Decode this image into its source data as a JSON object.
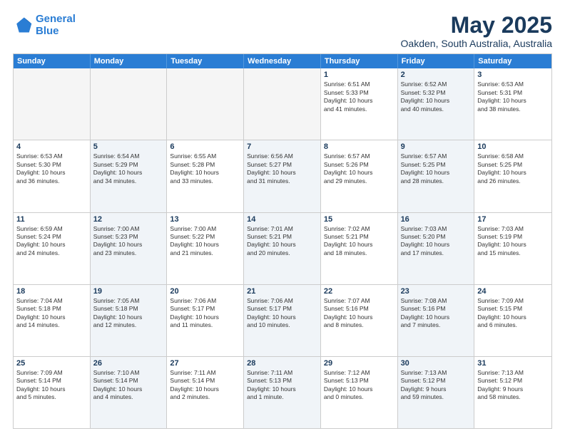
{
  "logo": {
    "line1": "General",
    "line2": "Blue"
  },
  "title": "May 2025",
  "subtitle": "Oakden, South Australia, Australia",
  "header_days": [
    "Sunday",
    "Monday",
    "Tuesday",
    "Wednesday",
    "Thursday",
    "Friday",
    "Saturday"
  ],
  "rows": [
    [
      {
        "day": "",
        "info": "",
        "empty": true
      },
      {
        "day": "",
        "info": "",
        "empty": true
      },
      {
        "day": "",
        "info": "",
        "empty": true
      },
      {
        "day": "",
        "info": "",
        "empty": true
      },
      {
        "day": "1",
        "info": "Sunrise: 6:51 AM\nSunset: 5:33 PM\nDaylight: 10 hours\nand 41 minutes.",
        "shaded": false
      },
      {
        "day": "2",
        "info": "Sunrise: 6:52 AM\nSunset: 5:32 PM\nDaylight: 10 hours\nand 40 minutes.",
        "shaded": true
      },
      {
        "day": "3",
        "info": "Sunrise: 6:53 AM\nSunset: 5:31 PM\nDaylight: 10 hours\nand 38 minutes.",
        "shaded": false
      }
    ],
    [
      {
        "day": "4",
        "info": "Sunrise: 6:53 AM\nSunset: 5:30 PM\nDaylight: 10 hours\nand 36 minutes.",
        "shaded": false
      },
      {
        "day": "5",
        "info": "Sunrise: 6:54 AM\nSunset: 5:29 PM\nDaylight: 10 hours\nand 34 minutes.",
        "shaded": true
      },
      {
        "day": "6",
        "info": "Sunrise: 6:55 AM\nSunset: 5:28 PM\nDaylight: 10 hours\nand 33 minutes.",
        "shaded": false
      },
      {
        "day": "7",
        "info": "Sunrise: 6:56 AM\nSunset: 5:27 PM\nDaylight: 10 hours\nand 31 minutes.",
        "shaded": true
      },
      {
        "day": "8",
        "info": "Sunrise: 6:57 AM\nSunset: 5:26 PM\nDaylight: 10 hours\nand 29 minutes.",
        "shaded": false
      },
      {
        "day": "9",
        "info": "Sunrise: 6:57 AM\nSunset: 5:25 PM\nDaylight: 10 hours\nand 28 minutes.",
        "shaded": true
      },
      {
        "day": "10",
        "info": "Sunrise: 6:58 AM\nSunset: 5:25 PM\nDaylight: 10 hours\nand 26 minutes.",
        "shaded": false
      }
    ],
    [
      {
        "day": "11",
        "info": "Sunrise: 6:59 AM\nSunset: 5:24 PM\nDaylight: 10 hours\nand 24 minutes.",
        "shaded": false
      },
      {
        "day": "12",
        "info": "Sunrise: 7:00 AM\nSunset: 5:23 PM\nDaylight: 10 hours\nand 23 minutes.",
        "shaded": true
      },
      {
        "day": "13",
        "info": "Sunrise: 7:00 AM\nSunset: 5:22 PM\nDaylight: 10 hours\nand 21 minutes.",
        "shaded": false
      },
      {
        "day": "14",
        "info": "Sunrise: 7:01 AM\nSunset: 5:21 PM\nDaylight: 10 hours\nand 20 minutes.",
        "shaded": true
      },
      {
        "day": "15",
        "info": "Sunrise: 7:02 AM\nSunset: 5:21 PM\nDaylight: 10 hours\nand 18 minutes.",
        "shaded": false
      },
      {
        "day": "16",
        "info": "Sunrise: 7:03 AM\nSunset: 5:20 PM\nDaylight: 10 hours\nand 17 minutes.",
        "shaded": true
      },
      {
        "day": "17",
        "info": "Sunrise: 7:03 AM\nSunset: 5:19 PM\nDaylight: 10 hours\nand 15 minutes.",
        "shaded": false
      }
    ],
    [
      {
        "day": "18",
        "info": "Sunrise: 7:04 AM\nSunset: 5:18 PM\nDaylight: 10 hours\nand 14 minutes.",
        "shaded": false
      },
      {
        "day": "19",
        "info": "Sunrise: 7:05 AM\nSunset: 5:18 PM\nDaylight: 10 hours\nand 12 minutes.",
        "shaded": true
      },
      {
        "day": "20",
        "info": "Sunrise: 7:06 AM\nSunset: 5:17 PM\nDaylight: 10 hours\nand 11 minutes.",
        "shaded": false
      },
      {
        "day": "21",
        "info": "Sunrise: 7:06 AM\nSunset: 5:17 PM\nDaylight: 10 hours\nand 10 minutes.",
        "shaded": true
      },
      {
        "day": "22",
        "info": "Sunrise: 7:07 AM\nSunset: 5:16 PM\nDaylight: 10 hours\nand 8 minutes.",
        "shaded": false
      },
      {
        "day": "23",
        "info": "Sunrise: 7:08 AM\nSunset: 5:16 PM\nDaylight: 10 hours\nand 7 minutes.",
        "shaded": true
      },
      {
        "day": "24",
        "info": "Sunrise: 7:09 AM\nSunset: 5:15 PM\nDaylight: 10 hours\nand 6 minutes.",
        "shaded": false
      }
    ],
    [
      {
        "day": "25",
        "info": "Sunrise: 7:09 AM\nSunset: 5:14 PM\nDaylight: 10 hours\nand 5 minutes.",
        "shaded": false
      },
      {
        "day": "26",
        "info": "Sunrise: 7:10 AM\nSunset: 5:14 PM\nDaylight: 10 hours\nand 4 minutes.",
        "shaded": true
      },
      {
        "day": "27",
        "info": "Sunrise: 7:11 AM\nSunset: 5:14 PM\nDaylight: 10 hours\nand 2 minutes.",
        "shaded": false
      },
      {
        "day": "28",
        "info": "Sunrise: 7:11 AM\nSunset: 5:13 PM\nDaylight: 10 hours\nand 1 minute.",
        "shaded": true
      },
      {
        "day": "29",
        "info": "Sunrise: 7:12 AM\nSunset: 5:13 PM\nDaylight: 10 hours\nand 0 minutes.",
        "shaded": false
      },
      {
        "day": "30",
        "info": "Sunrise: 7:13 AM\nSunset: 5:12 PM\nDaylight: 9 hours\nand 59 minutes.",
        "shaded": true
      },
      {
        "day": "31",
        "info": "Sunrise: 7:13 AM\nSunset: 5:12 PM\nDaylight: 9 hours\nand 58 minutes.",
        "shaded": false
      }
    ]
  ]
}
